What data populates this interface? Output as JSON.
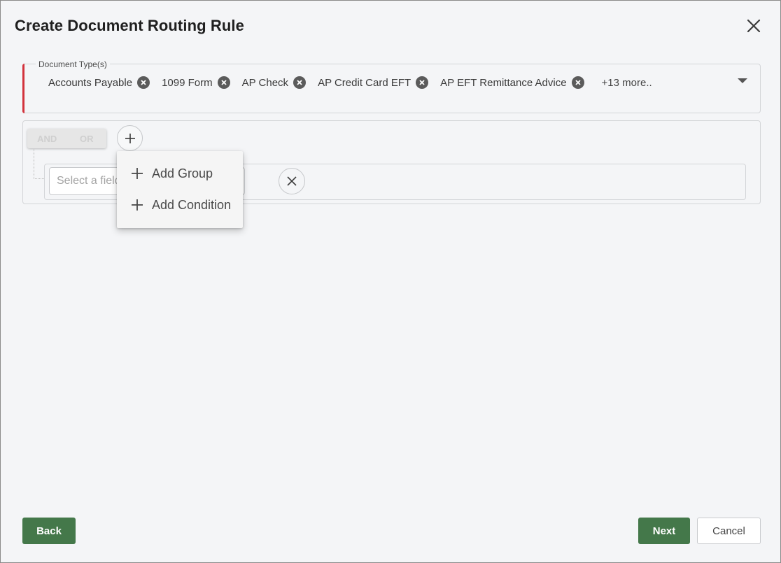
{
  "dialog": {
    "title": "Create Document Routing Rule"
  },
  "document_types": {
    "label": "Document Type(s)",
    "chips": [
      "Accounts Payable",
      "1099 Form",
      "AP Check",
      "AP Credit Card EFT",
      "AP EFT Remittance Advice"
    ],
    "more": "+13 more.."
  },
  "query": {
    "and_label": "AND",
    "or_label": "OR",
    "field_placeholder": "Select a field"
  },
  "menu": {
    "add_group": "Add Group",
    "add_condition": "Add Condition"
  },
  "footer": {
    "back": "Back",
    "next": "Next",
    "cancel": "Cancel"
  },
  "colors": {
    "primary": "#44784a",
    "error": "#d2323c"
  }
}
